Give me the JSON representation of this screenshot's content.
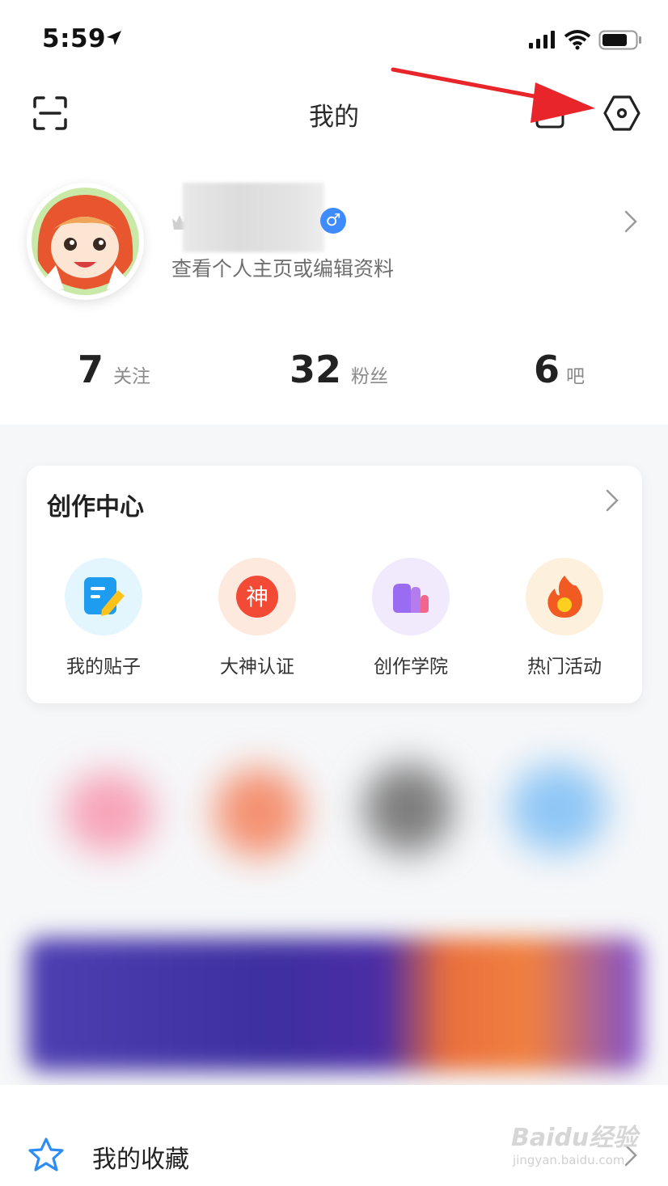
{
  "status_bar": {
    "time": "5:59"
  },
  "header": {
    "title": "我的"
  },
  "profile": {
    "subtitle": "查看个人主页或编辑资料",
    "gender_symbol": "♂"
  },
  "stats": [
    {
      "value": "7",
      "label": "关注"
    },
    {
      "value": "32",
      "label": "粉丝"
    },
    {
      "value": "6",
      "label": "吧"
    }
  ],
  "creation_center": {
    "title": "创作中心",
    "tools": [
      {
        "label": "我的贴子",
        "icon": "edit-note-icon",
        "bg": "#e3f6fd"
      },
      {
        "label": "大神认证",
        "icon": "shen-badge-icon",
        "glyph": "神",
        "bg": "#fde9de"
      },
      {
        "label": "创作学院",
        "icon": "bar-chart-icon",
        "bg": "#f1eafc"
      },
      {
        "label": "热门活动",
        "icon": "fire-icon",
        "bg": "#fdf0dc"
      }
    ]
  },
  "favorites": {
    "label": "我的收藏"
  },
  "watermark": {
    "main": "Baidu经验",
    "sub": "jingyan.baidu.com"
  },
  "colors": {
    "accent_blue": "#3d8bfd",
    "annotation_red": "#e8252a"
  }
}
